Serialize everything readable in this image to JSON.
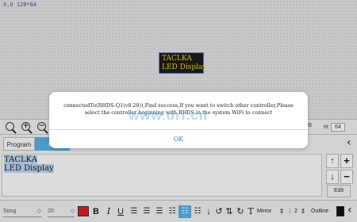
{
  "canvas": {
    "coords": "0,0 128*64",
    "led_text_line1": "TACLKA",
    "led_text_line2": "LED Display",
    "led_bg_color": "#1c1c1c",
    "led_text_color": "#f0d61b"
  },
  "top_toolbar": {
    "search_icon": "search-icon",
    "zoom_in_icon": "zoom-in-icon",
    "zoom_out_icon": "zoom-out-icon",
    "right_label_a": "28",
    "right_label_b": "H:",
    "right_value_b": "64"
  },
  "tabs": [
    {
      "label": "Program"
    },
    {
      "label": "Co"
    }
  ],
  "editor": {
    "line1": "TACLKA",
    "line2": "LED Display",
    "edit_label": "Edit"
  },
  "bottom_toolbar": {
    "font_name": "Song",
    "font_size": "20",
    "bold": "B",
    "italic": "I",
    "underline": "U",
    "mirror_label": "Mirror",
    "line_value": "2",
    "outline_label": "Outline",
    "color_red": "#e02020",
    "color_black": "#111111"
  },
  "dialog": {
    "message": "connectedTo(RHDS-Q1(v8.28)),Find success,If you want to switch other controller,Please select the controller beginning with RHDS in the system WiFi to connect",
    "ok_label": "OK"
  },
  "watermark": "www.dri.cn"
}
